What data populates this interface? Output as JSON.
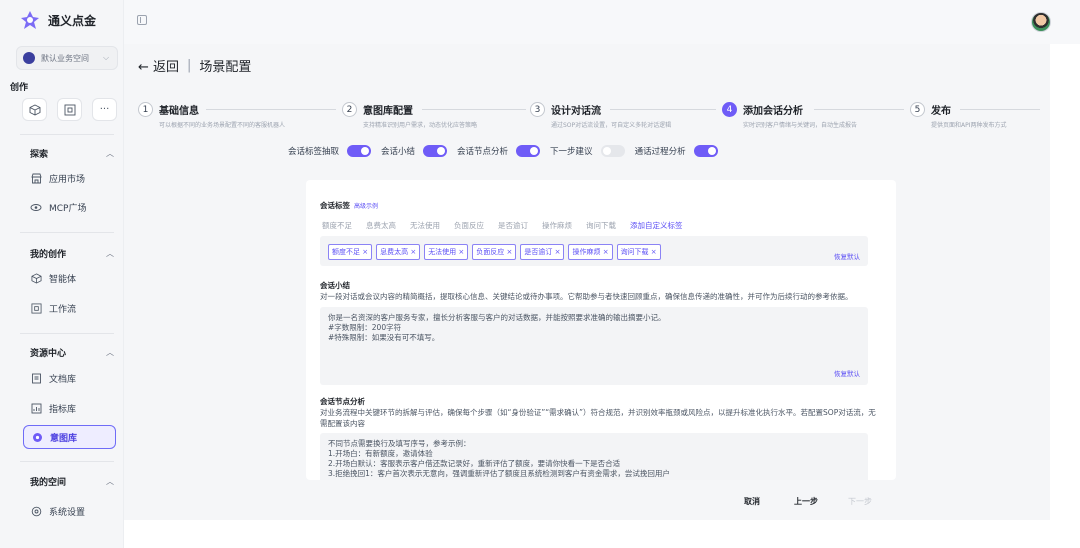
{
  "app": {
    "name": "通义点金",
    "workspace": "默认业务空间"
  },
  "sidebar": {
    "create_title": "创作",
    "create_buttons": [
      "cube",
      "frame",
      "more"
    ],
    "groups": [
      {
        "title": "探索",
        "items": [
          "应用市场",
          "MCP广场"
        ]
      },
      {
        "title": "我的创作",
        "items": [
          "智能体",
          "工作流"
        ]
      },
      {
        "title": "资源中心",
        "items": [
          "文档库",
          "指标库",
          "意图库"
        ]
      },
      {
        "title": "我的空间",
        "items": [
          "系统设置"
        ]
      }
    ],
    "active_item": "意图库"
  },
  "header": {
    "back_label": "← 返回",
    "separator": "|",
    "title": "场景配置"
  },
  "steps": [
    {
      "num": "1",
      "title": "基础信息",
      "desc": "可以根据不同的业务场景配置不同的客服机器人"
    },
    {
      "num": "2",
      "title": "意图库配置",
      "desc": "支持精准识别用户需求，动态优化应答策略"
    },
    {
      "num": "3",
      "title": "设计对话流",
      "desc": "通过SOP对话流设置，可自定义多轮对话逻辑"
    },
    {
      "num": "4",
      "title": "添加会话分析",
      "desc": "实时识别客户情绪与关键词，自动生成报告"
    },
    {
      "num": "5",
      "title": "发布",
      "desc": "提供页面和API两种发布方式"
    }
  ],
  "toggles": [
    {
      "label": "会话标签抽取",
      "on": true
    },
    {
      "label": "会话小结",
      "on": true
    },
    {
      "label": "会话节点分析",
      "on": true
    },
    {
      "label": "下一步建议",
      "on": false
    },
    {
      "label": "通话过程分析",
      "on": true
    }
  ],
  "tags": {
    "title": "会话标签",
    "example_link": "高级示例",
    "options": [
      "额度不足",
      "息费太高",
      "无法使用",
      "负面反应",
      "是否逾订",
      "操作麻烦",
      "询问下载"
    ],
    "add_label": "添加自定义标签",
    "chips": [
      "额度不足 ×",
      "息费太高 ×",
      "无法使用 ×",
      "负面反应 ×",
      "是否逾订 ×",
      "操作麻烦 ×",
      "询问下载 ×"
    ],
    "restore_label": "恢复默认"
  },
  "summary": {
    "title": "会话小结",
    "desc": "对一段对话或会议内容的精简概括，提取核心信息、关键结论或待办事项。它帮助参与者快速回顾重点，确保信息传递的准确性，并可作为后续行动的参考依据。",
    "lines": [
      "你是一名资深的客户服务专家，擅长分析客服与客户的对话数据，并能按照要求准确的输出摘要小记。",
      "#字数限制：200字符",
      "#特殊限制：如果没有可不填写。"
    ],
    "restore_label": "恢复默认"
  },
  "node_analysis": {
    "title": "会话节点分析",
    "desc": "对业务流程中关键环节的拆解与评估，确保每个步骤（如“身份验证”“需求确认”）符合规范，并识别效率瓶颈或风险点，以提升标准化执行水平。若配置SOP对话流，无需配置该内容",
    "lines": [
      "不同节点需要换行及填写序号，参考示例：",
      "1.开场白：有新额度，邀请体验",
      "2.开场白默认：客服表示客户借还款记录好，重新评估了额度，要请你快看一下是否合适",
      "3.拒绝挽回1：客户首次表示无意向，强调重新评估了额度且系统检测到客户有资金需求，尝试挽回用户"
    ]
  },
  "footer": {
    "cancel": "取消",
    "prev": "上一步",
    "next": "下一步"
  }
}
